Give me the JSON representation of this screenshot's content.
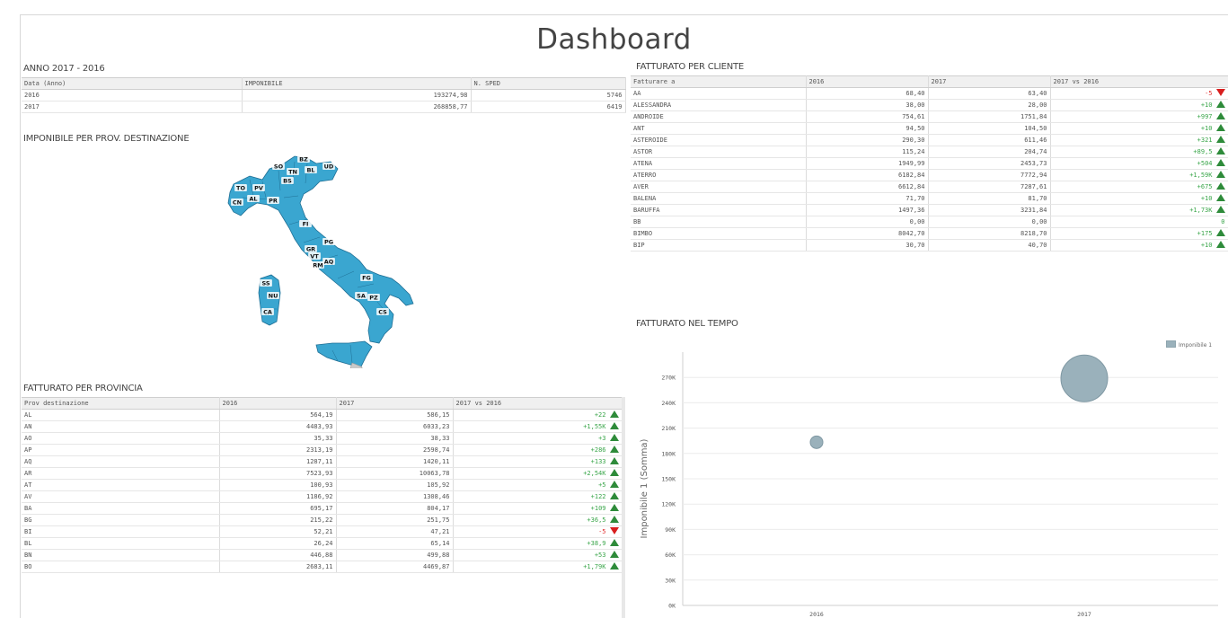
{
  "title": "Dashboard",
  "anno": {
    "title": "ANNO 2017 - 2016",
    "headers": [
      "Data (Anno)",
      "IMPONIBILE",
      "N. SPED"
    ],
    "rows": [
      [
        "2016",
        "193274,98",
        "5746"
      ],
      [
        "2017",
        "268858,77",
        "6419"
      ]
    ]
  },
  "map": {
    "title": "IMPONIBILE PER PROV. DESTINAZIONE",
    "land_color": "#3aa6d0",
    "labels": [
      "BZ",
      "SO",
      "BL",
      "UD",
      "TN",
      "BS",
      "TO",
      "PV",
      "CN",
      "AL",
      "PR",
      "FI",
      "PG",
      "GR",
      "VT",
      "AQ",
      "RM",
      "FG",
      "SA",
      "PZ",
      "CS",
      "SS",
      "NU",
      "CA"
    ]
  },
  "provincia": {
    "title": "FATTURATO PER PROVINCIA",
    "headers": [
      "Prov destinazione",
      "2016",
      "2017",
      "2017 vs 2016"
    ],
    "rows": [
      {
        "name": "AL",
        "v2016": "564,19",
        "v2017": "586,15",
        "delta": "+22",
        "dir": "up"
      },
      {
        "name": "AN",
        "v2016": "4483,93",
        "v2017": "6033,23",
        "delta": "+1,55K",
        "dir": "up"
      },
      {
        "name": "AO",
        "v2016": "35,33",
        "v2017": "38,33",
        "delta": "+3",
        "dir": "up"
      },
      {
        "name": "AP",
        "v2016": "2313,19",
        "v2017": "2598,74",
        "delta": "+286",
        "dir": "up"
      },
      {
        "name": "AQ",
        "v2016": "1287,11",
        "v2017": "1420,11",
        "delta": "+133",
        "dir": "up"
      },
      {
        "name": "AR",
        "v2016": "7523,93",
        "v2017": "10063,78",
        "delta": "+2,54K",
        "dir": "up"
      },
      {
        "name": "AT",
        "v2016": "100,93",
        "v2017": "105,92",
        "delta": "+5",
        "dir": "up"
      },
      {
        "name": "AV",
        "v2016": "1186,92",
        "v2017": "1308,46",
        "delta": "+122",
        "dir": "up"
      },
      {
        "name": "BA",
        "v2016": "695,17",
        "v2017": "804,17",
        "delta": "+109",
        "dir": "up"
      },
      {
        "name": "BG",
        "v2016": "215,22",
        "v2017": "251,75",
        "delta": "+36,5",
        "dir": "up"
      },
      {
        "name": "BI",
        "v2016": "52,21",
        "v2017": "47,21",
        "delta": "-5",
        "dir": "down"
      },
      {
        "name": "BL",
        "v2016": "26,24",
        "v2017": "65,14",
        "delta": "+38,9",
        "dir": "up"
      },
      {
        "name": "BN",
        "v2016": "446,88",
        "v2017": "499,88",
        "delta": "+53",
        "dir": "up"
      },
      {
        "name": "BO",
        "v2016": "2683,11",
        "v2017": "4469,87",
        "delta": "+1,79K",
        "dir": "up"
      }
    ]
  },
  "cliente": {
    "title": "FATTURATO PER CLIENTE",
    "headers": [
      "Fatturare a",
      "2016",
      "2017",
      "2017 vs 2016"
    ],
    "rows": [
      {
        "name": "AA",
        "v2016": "68,40",
        "v2017": "63,40",
        "delta": "-5",
        "dir": "down"
      },
      {
        "name": "ALESSANDRA",
        "v2016": "38,00",
        "v2017": "28,00",
        "delta": "+10",
        "dir": "up"
      },
      {
        "name": "ANDROIDE",
        "v2016": "754,61",
        "v2017": "1751,84",
        "delta": "+997",
        "dir": "up"
      },
      {
        "name": "ANT",
        "v2016": "94,50",
        "v2017": "104,50",
        "delta": "+10",
        "dir": "up"
      },
      {
        "name": "ASTEROIDE",
        "v2016": "290,30",
        "v2017": "611,46",
        "delta": "+321",
        "dir": "up"
      },
      {
        "name": "ASTOR",
        "v2016": "115,24",
        "v2017": "204,74",
        "delta": "+89,5",
        "dir": "up"
      },
      {
        "name": "ATENA",
        "v2016": "1949,99",
        "v2017": "2453,73",
        "delta": "+504",
        "dir": "up"
      },
      {
        "name": "ATERRO",
        "v2016": "6182,84",
        "v2017": "7772,94",
        "delta": "+1,59K",
        "dir": "up"
      },
      {
        "name": "AVER",
        "v2016": "6612,84",
        "v2017": "7287,61",
        "delta": "+675",
        "dir": "up"
      },
      {
        "name": "BALENA",
        "v2016": "71,70",
        "v2017": "81,70",
        "delta": "+10",
        "dir": "up"
      },
      {
        "name": "BARUFFA",
        "v2016": "1497,36",
        "v2017": "3231,84",
        "delta": "+1,73K",
        "dir": "up"
      },
      {
        "name": "BB",
        "v2016": "0,00",
        "v2017": "0,00",
        "delta": "0",
        "dir": "none"
      },
      {
        "name": "BIMBO",
        "v2016": "8042,70",
        "v2017": "8218,70",
        "delta": "+175",
        "dir": "up"
      },
      {
        "name": "BIP",
        "v2016": "30,70",
        "v2017": "40,70",
        "delta": "+10",
        "dir": "up"
      }
    ]
  },
  "tempo": {
    "title": "FATTURATO NEL TEMPO",
    "legend": "Imponibile 1",
    "ylabel": "Imponibile 1 (Somma)",
    "colors": {
      "bubble": "#9ab1bb",
      "bubble_edge": "#7f98a3"
    }
  },
  "chart_data": {
    "type": "scatter",
    "title": "FATTURATO NEL TEMPO",
    "xlabel": "",
    "ylabel": "Imponibile 1 (Somma)",
    "x": [
      "2016",
      "2017"
    ],
    "y": [
      193274.98,
      268858.77
    ],
    "ylim": [
      0,
      300000
    ],
    "yticks": [
      0,
      30000,
      60000,
      90000,
      120000,
      150000,
      180000,
      210000,
      240000,
      270000
    ],
    "ytick_labels": [
      "0K",
      "30K",
      "60K",
      "90K",
      "120K",
      "150K",
      "180K",
      "210K",
      "240K",
      "270K"
    ],
    "series": [
      {
        "name": "Imponibile 1",
        "x": [
          "2016",
          "2017"
        ],
        "y": [
          193274.98,
          268858.77
        ]
      }
    ],
    "legend": "top-right",
    "grid": true
  }
}
